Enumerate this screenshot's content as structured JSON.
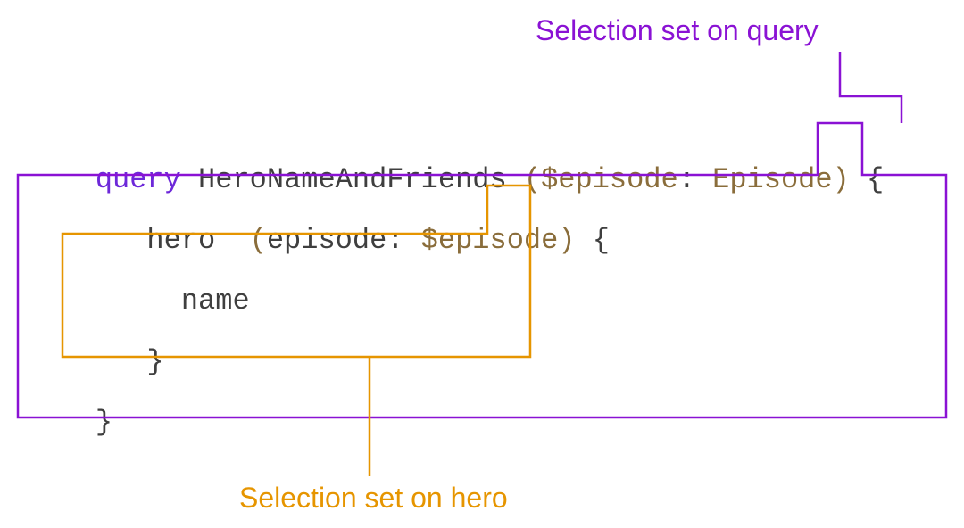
{
  "labels": {
    "outer": "Selection set on query",
    "inner": "Selection set on hero"
  },
  "code": {
    "line1": {
      "keyword": "query",
      "opName": "HeroNameAndFriends",
      "lparen": "(",
      "variable": "$episode",
      "colon": ":",
      "type": "Episode",
      "rparen": ")",
      "lbrace": "{"
    },
    "line2": {
      "field": "hero",
      "lparen": "(",
      "arg": "episode",
      "colon": ":",
      "variable": "$episode",
      "rparen": ")",
      "lbrace": "{"
    },
    "line3": {
      "field": "name"
    },
    "line4": {
      "rbrace": "}"
    },
    "line5": {
      "rbrace": "}"
    }
  },
  "colors": {
    "purple": "#8a12d4",
    "orange": "#e69500"
  },
  "chart_data": {
    "type": "diagram",
    "description": "Annotated GraphQL query showing two nested selection sets.",
    "query_text": "query HeroNameAndFriends ($episode: Episode) {\n  hero (episode: $episode) {\n    name\n  }\n}",
    "annotations": [
      {
        "label": "Selection set on query",
        "color": "#8a12d4",
        "encloses_lines": [
          2,
          3,
          4,
          5
        ],
        "starts_at_brace_on_line": 1
      },
      {
        "label": "Selection set on hero",
        "color": "#e69500",
        "encloses_lines": [
          3,
          4
        ],
        "starts_at_brace_on_line": 2
      }
    ]
  }
}
